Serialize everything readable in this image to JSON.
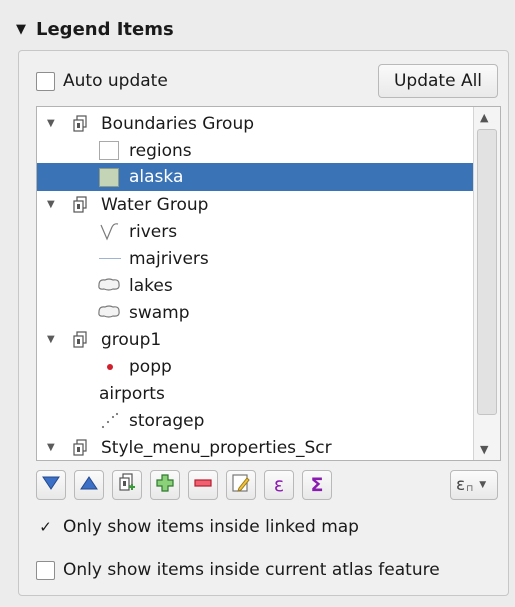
{
  "header": {
    "title": "Legend Items"
  },
  "auto_update": {
    "label": "Auto update",
    "checked": false
  },
  "update_all_label": "Update All",
  "tree": {
    "rows": [
      {
        "label": "Boundaries Group",
        "type": "group",
        "expanded": true
      },
      {
        "label": "regions",
        "type": "layer",
        "symbol": "white-square"
      },
      {
        "label": "alaska",
        "type": "layer",
        "symbol": "green-square",
        "selected": true
      },
      {
        "label": "Water Group",
        "type": "group",
        "expanded": true
      },
      {
        "label": "rivers",
        "type": "layer",
        "symbol": "river-line"
      },
      {
        "label": "majrivers",
        "type": "layer",
        "symbol": "blue-line"
      },
      {
        "label": "lakes",
        "type": "layer",
        "symbol": "polygon"
      },
      {
        "label": "swamp",
        "type": "layer",
        "symbol": "polygon"
      },
      {
        "label": "group1",
        "type": "group",
        "expanded": true
      },
      {
        "label": "popp",
        "type": "layer",
        "symbol": "red-dot"
      },
      {
        "label": "airports",
        "type": "layer",
        "symbol": "none"
      },
      {
        "label": "storagep",
        "type": "layer",
        "symbol": "dots"
      },
      {
        "label": "Style_menu_properties_Scr",
        "type": "group",
        "expanded": true
      }
    ]
  },
  "toolbar": {
    "buttons": [
      {
        "name": "move-down-button",
        "icon": "triangle-down-icon"
      },
      {
        "name": "move-up-button",
        "icon": "triangle-up-icon"
      },
      {
        "name": "add-group-button",
        "icon": "add-group-icon"
      },
      {
        "name": "add-item-button",
        "icon": "plus-icon"
      },
      {
        "name": "remove-item-button",
        "icon": "minus-icon"
      },
      {
        "name": "edit-item-button",
        "icon": "edit-icon"
      },
      {
        "name": "expression-button",
        "icon": "epsilon-icon",
        "glyph": "ε"
      },
      {
        "name": "sum-button",
        "icon": "sigma-icon",
        "glyph": "Σ"
      }
    ],
    "filter_glyph": "ε"
  },
  "options": {
    "linked_map": {
      "label": "Only show items inside linked map",
      "checked": true,
      "mark": "✓"
    },
    "atlas_feature": {
      "label": "Only show items inside current atlas feature",
      "checked": false
    }
  },
  "colors": {
    "selection": "#3b74b6",
    "minus": "#d7263d",
    "plus_green": "#3a9a3a",
    "epsilon": "#8a1bb0",
    "arrow_blue": "#3c6fc6"
  }
}
